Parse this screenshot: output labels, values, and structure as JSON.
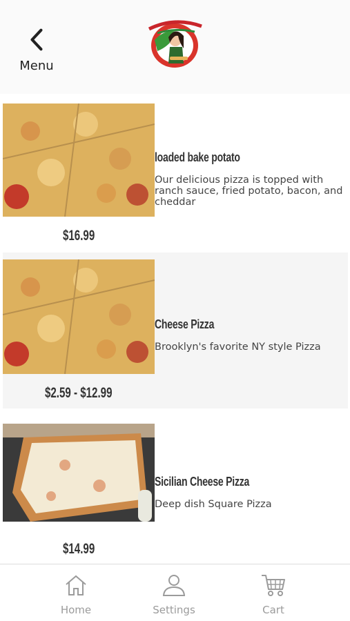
{
  "header": {
    "back_label": "Menu"
  },
  "items": [
    {
      "title": "loaded bake potato",
      "description": "Our delicious pizza is topped with ranch sauce, fried potato, bacon, and cheddar",
      "price": "$16.99"
    },
    {
      "title": "Cheese Pizza",
      "description": "Brooklyn's favorite NY style Pizza",
      "price": "$2.59 - $12.99"
    },
    {
      "title": "Sicilian Cheese Pizza",
      "description": "Deep dish Square Pizza",
      "price": "$14.99"
    }
  ],
  "nav": {
    "home": "Home",
    "settings": "Settings",
    "cart": "Cart"
  },
  "colors": {
    "nav_icon": "#9b9b9b",
    "shaded_row": "#f5f5f5"
  },
  "icons": [
    "chevron-left-icon",
    "home-icon",
    "user-icon",
    "cart-icon"
  ]
}
